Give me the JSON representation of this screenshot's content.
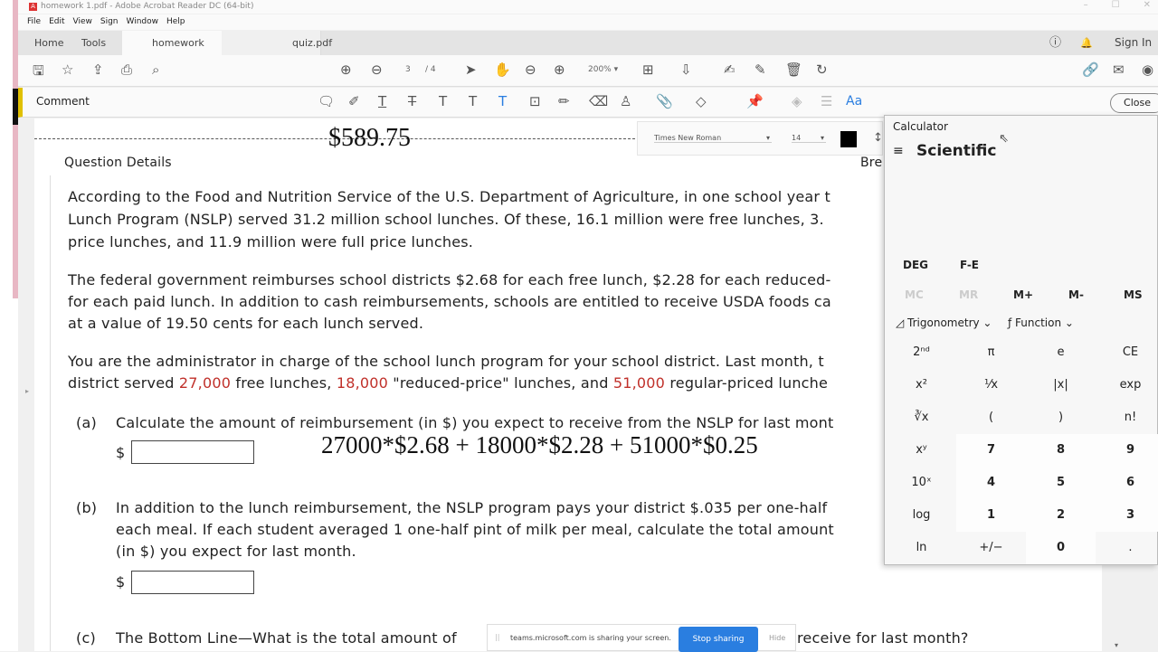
{
  "window": {
    "title": "homework 1.pdf - Adobe Acrobat Reader DC (64-bit)",
    "controls": [
      "–",
      "☐",
      "✕"
    ]
  },
  "menu": [
    "File",
    "Edit",
    "View",
    "Sign",
    "Window",
    "Help"
  ],
  "tabs": {
    "home": "Home",
    "tools": "Tools",
    "active": "homework 1.pdf",
    "close": "×",
    "other": "quiz.pdf",
    "sign_in": "Sign In"
  },
  "toolbar": {
    "page_current": "3",
    "page_total": "/ 4",
    "zoom": "200%"
  },
  "comment": {
    "label": "Comment",
    "font_name": "Times New Roman",
    "font_size": "14",
    "text_color": "#000000",
    "close": "Close",
    "aa": "Aa"
  },
  "document": {
    "top_amount": "$589.75",
    "section_title": "Question Details",
    "right_cut": "Bre",
    "p1": [
      "According to the Food and Nutrition Service of the U.S. Department of Agriculture, in one school year t",
      "Lunch Program (NSLP) served 31.2 million school lunches. Of these, 16.1 million were free lunches, 3.",
      "price lunches, and 11.9 million were full price lunches."
    ],
    "p2": [
      "The federal government reimburses school districts $2.68 for each free lunch, $2.28 for each reduced-",
      "for each paid lunch. In addition to cash reimbursements, schools are entitled to receive USDA foods ca",
      "at a value of 19.50 cents for each lunch served."
    ],
    "p3a": "You are the administrator in charge of the school lunch program for your school district. Last month, t",
    "p3b": {
      "a": "district served ",
      "v1": "27,000",
      "b": " free lunches, ",
      "v2": "18,000",
      "c": " \"reduced-price\" lunches, and ",
      "v3": "51,000",
      "d": " regular-priced lunche"
    },
    "qa": {
      "label": "(a)",
      "text": "Calculate the amount of reimbursement (in $) you expect to receive from the NSLP for last mont",
      "dollar": "$",
      "handwriting": "27000*$2.68  +  18000*$2.28  +  51000*$0.25"
    },
    "qb": {
      "label": "(b)",
      "lines": [
        "In addition to the lunch reimbursement, the NSLP program pays your district $.035 per one-half",
        "each meal. If each student averaged 1 one-half pint of milk per meal, calculate the total amount",
        "(in $) you expect for last month."
      ],
      "dollar": "$"
    },
    "qc": {
      "label": "(c)",
      "text_a": "The Bottom Line—What is the total amount of",
      "text_b": "receive for last month?"
    }
  },
  "calculator": {
    "title": "Calculator",
    "mode": "Scientific",
    "angle": "DEG",
    "fe": "F-E",
    "memory": [
      "MC",
      "MR",
      "M+",
      "M-",
      "MS"
    ],
    "trig": "Trigonometry",
    "func": "Function",
    "rows": [
      [
        "2ⁿᵈ",
        "π",
        "e",
        "CE"
      ],
      [
        "x²",
        "⅟x",
        "|x|",
        "exp"
      ],
      [
        "∛x",
        "(",
        ")",
        "n!"
      ],
      [
        "xʸ",
        "7",
        "8",
        "9"
      ],
      [
        "10ˣ",
        "4",
        "5",
        "6"
      ],
      [
        "log",
        "1",
        "2",
        "3"
      ],
      [
        "ln",
        "+/−",
        "0",
        "."
      ]
    ]
  },
  "share_bar": {
    "text": "teams.microsoft.com is sharing your screen.",
    "stop": "Stop sharing",
    "hide": "Hide"
  },
  "colors": {
    "accent": "#e0c000",
    "stop_button": "#2a7ee0",
    "red_values": "#c0302a"
  }
}
